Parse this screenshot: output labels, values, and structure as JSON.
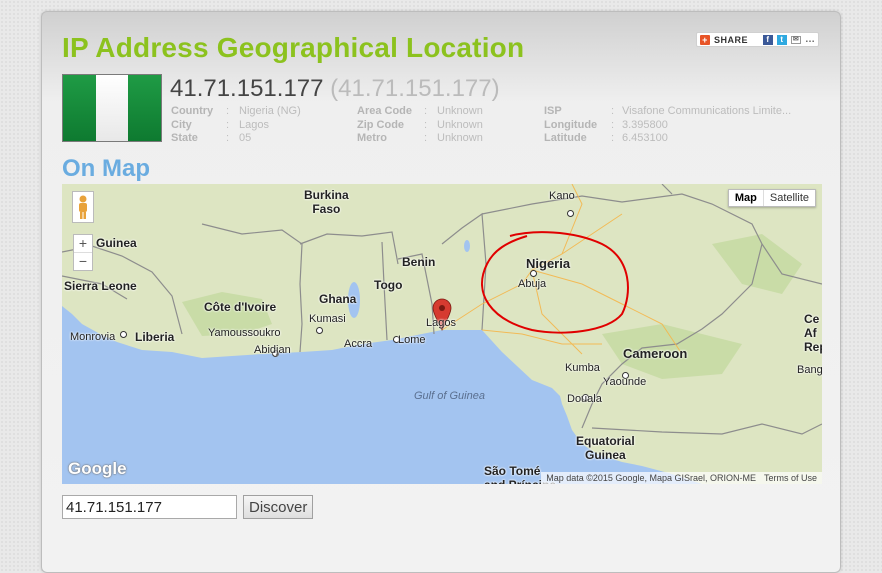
{
  "page": {
    "title": "IP Address Geographical Location",
    "map_heading": "On Map"
  },
  "share": {
    "label": "SHARE",
    "icons": [
      "plus-icon",
      "facebook-icon",
      "twitter-icon",
      "email-icon",
      "more-icon"
    ]
  },
  "flag": {
    "country": "Nigeria",
    "colors": [
      "#1f9b45",
      "#ffffff",
      "#1f9b45"
    ]
  },
  "ip": {
    "address": "41.71.151.177",
    "resolved": "(41.71.151.177)"
  },
  "details": {
    "country": {
      "label": "Country",
      "sep": ":",
      "value": "Nigeria (NG)"
    },
    "city": {
      "label": "City",
      "sep": ":",
      "value": "Lagos"
    },
    "state": {
      "label": "State",
      "sep": ":",
      "value": "05"
    },
    "area_code": {
      "label": "Area Code",
      "sep": ":",
      "value": "Unknown"
    },
    "zip_code": {
      "label": "Zip Code",
      "sep": ":",
      "value": "Unknown"
    },
    "metro": {
      "label": "Metro",
      "sep": ":",
      "value": "Unknown"
    },
    "isp": {
      "label": "ISP",
      "sep": ":",
      "value": "Visafone Communications Limite..."
    },
    "longitude": {
      "label": "Longitude",
      "sep": ":",
      "value": "3.395800"
    },
    "latitude": {
      "label": "Latitude",
      "sep": ":",
      "value": "6.453100"
    }
  },
  "map": {
    "type_buttons": {
      "map": "Map",
      "satellite": "Satellite"
    },
    "zoom": {
      "in": "+",
      "out": "−"
    },
    "google_logo": "Google",
    "attribution": "Map data ©2015 Google, Mapa GISrael, ORION-ME",
    "terms": "Terms of Use",
    "labels": {
      "burkina_faso": "Burkina\nFaso",
      "guinea": "Guinea",
      "sierra_leone": "Sierra Leone",
      "cote_divoire": "Côte d'Ivoire",
      "liberia": "Liberia",
      "ghana": "Ghana",
      "togo": "Togo",
      "benin": "Benin",
      "nigeria": "Nigeria",
      "cameroon": "Cameroon",
      "equatorial_guinea": "Equatorial\nGuinea",
      "kano": "Kano",
      "abuja": "Abuja",
      "lagos": "Lagos",
      "lome": "Lome",
      "accra": "Accra",
      "kumasi": "Kumasi",
      "abidjan": "Abidjan",
      "yamoussoukro": "Yamoussoukro",
      "monrovia": "Monrovia",
      "kumba": "Kumba",
      "douala": "Douala",
      "yaounde": "Yaounde",
      "bangui": "Bangui",
      "gulf_of_guinea": "Gulf of Guinea",
      "sao_tome": "São Tomé\nand Príncipe",
      "car_fragment": "Ce\nAf\nRep"
    },
    "marker_color": "#d63b30",
    "annotation_color": "#e00000",
    "water_color": "#a3c4f0",
    "land_color": "#dde5c2"
  },
  "search": {
    "value": "41.71.151.177",
    "button": "Discover"
  }
}
